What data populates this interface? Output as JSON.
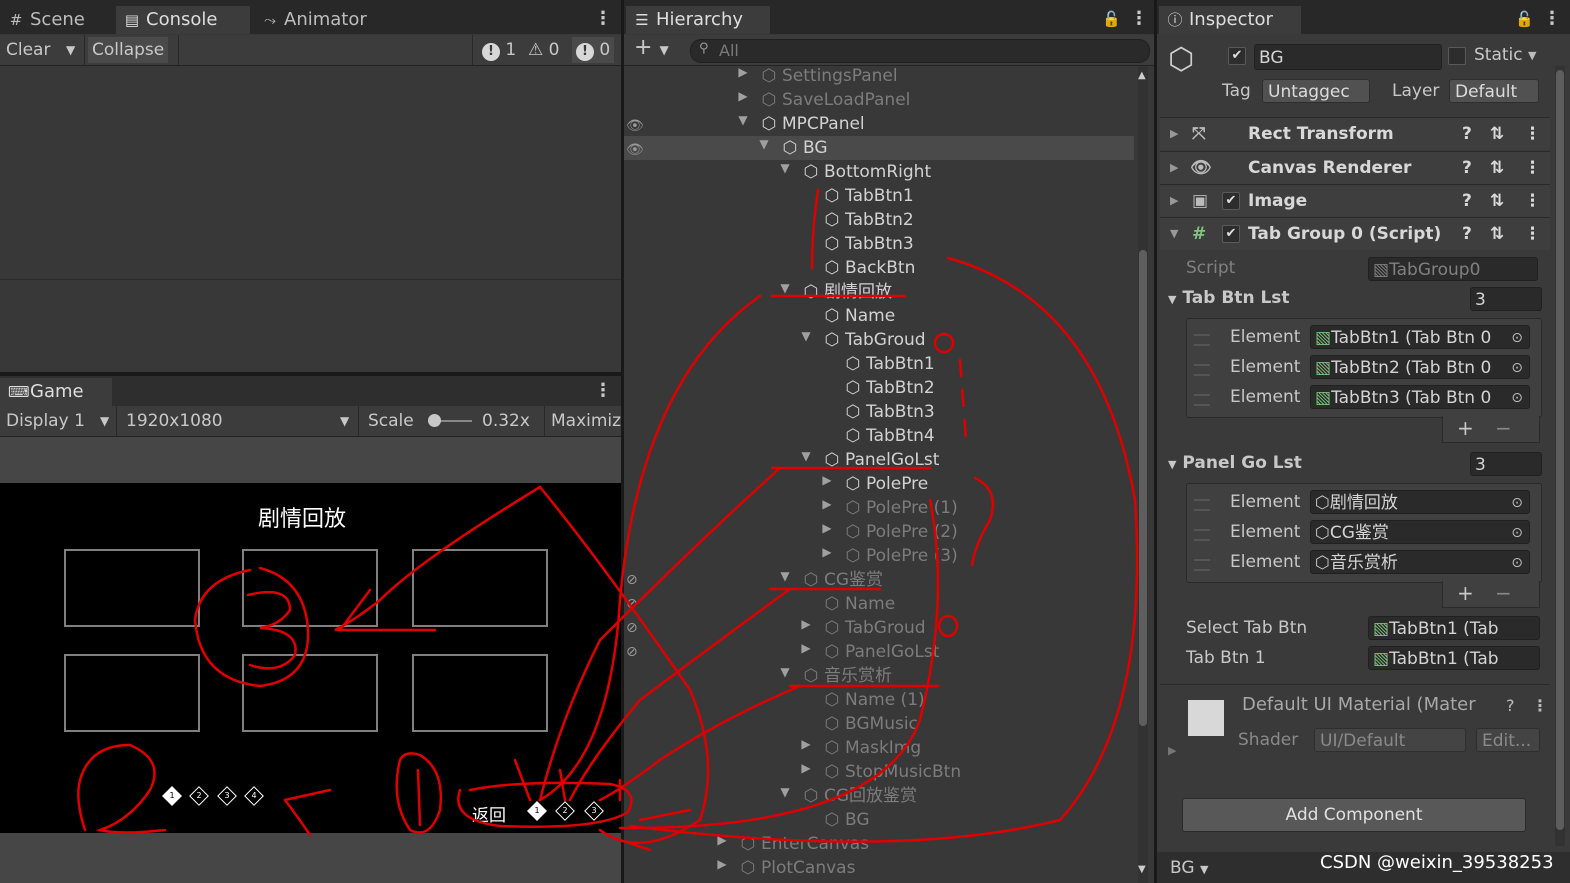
{
  "left_top": {
    "tabs": [
      {
        "icon": "#",
        "label": "Scene"
      },
      {
        "icon": "▤",
        "label": "Console"
      },
      {
        "icon": "⤳",
        "label": "Animator"
      }
    ],
    "clear": "Clear",
    "collapse": "Collapse",
    "counts": {
      "errors": "1",
      "warnings": "0",
      "info": "0"
    }
  },
  "game": {
    "tab": "Game",
    "display": "Display 1",
    "resolution": "1920x1080",
    "scale_label": "Scale",
    "scale_value": "0.32x",
    "maximize": "Maximiz",
    "title": "剧情回放",
    "back_label": "返回",
    "dots_left": [
      "1",
      "2",
      "3",
      "4"
    ],
    "dots_right": [
      "1",
      "2",
      "3"
    ]
  },
  "hierarchy": {
    "tab": "Hierarchy",
    "search_placeholder": "All",
    "rows": [
      {
        "label": "SettingsPanel",
        "dim": true
      },
      {
        "label": "SaveLoadPanel",
        "dim": true
      },
      {
        "label": "MPCPanel",
        "dim": false
      },
      {
        "label": "BG",
        "dim": false
      },
      {
        "label": "BottomRight",
        "dim": false
      },
      {
        "label": "TabBtn1",
        "dim": false
      },
      {
        "label": "TabBtn2",
        "dim": false
      },
      {
        "label": "TabBtn3",
        "dim": false
      },
      {
        "label": "BackBtn",
        "dim": false
      },
      {
        "label": "剧情回放",
        "dim": false
      },
      {
        "label": "Name",
        "dim": false
      },
      {
        "label": "TabGroud",
        "dim": false
      },
      {
        "label": "TabBtn1",
        "dim": false
      },
      {
        "label": "TabBtn2",
        "dim": false
      },
      {
        "label": "TabBtn3",
        "dim": false
      },
      {
        "label": "TabBtn4",
        "dim": false
      },
      {
        "label": "PanelGoLst",
        "dim": false
      },
      {
        "label": "PolePre",
        "dim": false
      },
      {
        "label": "PolePre (1)",
        "dim": true
      },
      {
        "label": "PolePre (2)",
        "dim": true
      },
      {
        "label": "PolePre (3)",
        "dim": true
      },
      {
        "label": "CG鉴赏",
        "dim": true
      },
      {
        "label": "Name",
        "dim": true
      },
      {
        "label": "TabGroud",
        "dim": true
      },
      {
        "label": "PanelGoLst",
        "dim": true
      },
      {
        "label": "音乐赏析",
        "dim": true
      },
      {
        "label": "Name (1)",
        "dim": true
      },
      {
        "label": "BGMusic",
        "dim": true
      },
      {
        "label": "MaskImg",
        "dim": true
      },
      {
        "label": "StopMusicBtn",
        "dim": true
      },
      {
        "label": "CG回放鉴赏",
        "dim": true
      },
      {
        "label": "BG",
        "dim": true
      },
      {
        "label": "EnterCanvas",
        "dim": true
      },
      {
        "label": "PlotCanvas",
        "dim": true
      }
    ]
  },
  "inspector": {
    "tab": "Inspector",
    "object_name": "BG",
    "static_label": "Static",
    "tag_label": "Tag",
    "tag_value": "Untaggec",
    "layer_label": "Layer",
    "layer_value": "Default",
    "components": [
      "Rect Transform",
      "Canvas Renderer",
      "Image",
      "Tab Group 0 (Script)"
    ],
    "script_label": "Script",
    "script_value": "TabGroup0",
    "tab_btn_lst_label": "Tab Btn Lst",
    "tab_btn_lst_count": "3",
    "tab_btn_elements": [
      {
        "label": "Element",
        "value": "TabBtn1 (Tab Btn 0"
      },
      {
        "label": "Element",
        "value": "TabBtn2 (Tab Btn 0"
      },
      {
        "label": "Element",
        "value": "TabBtn3 (Tab Btn 0"
      }
    ],
    "panel_go_lst_label": "Panel Go Lst",
    "panel_go_lst_count": "3",
    "panel_elements": [
      {
        "label": "Element",
        "value": "剧情回放"
      },
      {
        "label": "Element",
        "value": "CG鉴赏"
      },
      {
        "label": "Element",
        "value": "音乐赏析"
      }
    ],
    "select_tab_btn_label": "Select Tab Btn",
    "select_tab_btn_value": "TabBtn1 (Tab",
    "tab_btn_1_label": "Tab Btn 1",
    "tab_btn_1_value": "TabBtn1 (Tab",
    "material_label": "Default UI Material (Mater",
    "shader_label": "Shader",
    "shader_value": "UI/Default",
    "edit_label": "Edit...",
    "add_component": "Add Component",
    "footer_name": "BG"
  },
  "watermark": "CSDN @weixin_39538253"
}
